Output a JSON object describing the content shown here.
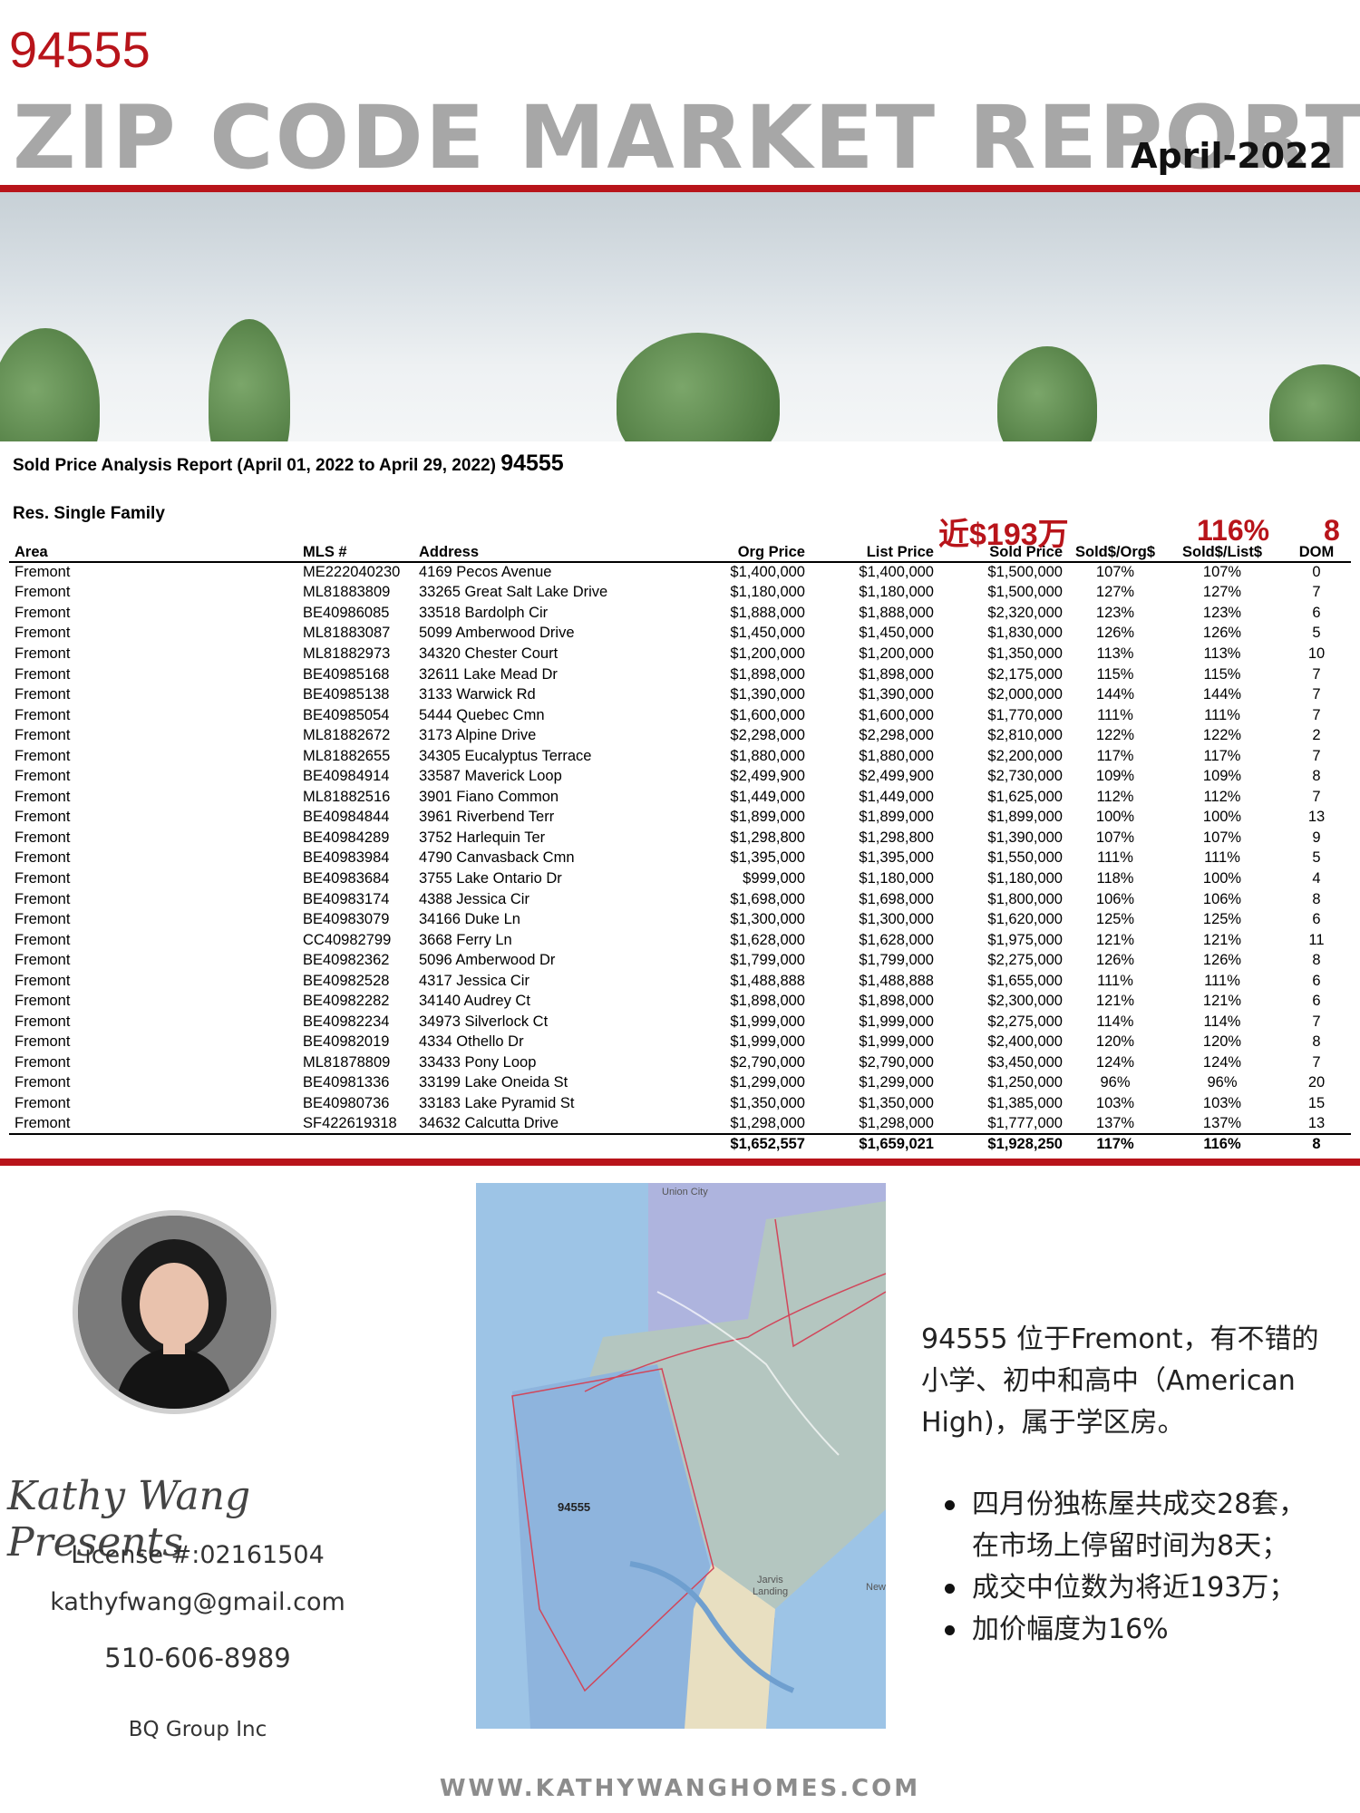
{
  "header": {
    "zip": "94555",
    "title": "ZIP CODE MARKET REPORT",
    "date": "April-2022"
  },
  "report": {
    "title": "Sold Price Analysis Report (April 01, 2022 to April 29, 2022)",
    "zip": "94555",
    "category": "Res. Single Family",
    "highlight_price": "近$193万",
    "highlight_ratio": "116%",
    "highlight_dom": "8",
    "columns": [
      "Area",
      "MLS #",
      "Address",
      "Org Price",
      "List Price",
      "Sold Price",
      "Sold$/Org$",
      "Sold$/List$",
      "DOM"
    ],
    "rows": [
      [
        "Fremont",
        "ME222040230",
        "4169 Pecos Avenue",
        "$1,400,000",
        "$1,400,000",
        "$1,500,000",
        "107%",
        "107%",
        "0"
      ],
      [
        "Fremont",
        "ML81883809",
        "33265 Great Salt Lake Drive",
        "$1,180,000",
        "$1,180,000",
        "$1,500,000",
        "127%",
        "127%",
        "7"
      ],
      [
        "Fremont",
        "BE40986085",
        "33518 Bardolph Cir",
        "$1,888,000",
        "$1,888,000",
        "$2,320,000",
        "123%",
        "123%",
        "6"
      ],
      [
        "Fremont",
        "ML81883087",
        "5099 Amberwood Drive",
        "$1,450,000",
        "$1,450,000",
        "$1,830,000",
        "126%",
        "126%",
        "5"
      ],
      [
        "Fremont",
        "ML81882973",
        "34320 Chester Court",
        "$1,200,000",
        "$1,200,000",
        "$1,350,000",
        "113%",
        "113%",
        "10"
      ],
      [
        "Fremont",
        "BE40985168",
        "32611 Lake Mead Dr",
        "$1,898,000",
        "$1,898,000",
        "$2,175,000",
        "115%",
        "115%",
        "7"
      ],
      [
        "Fremont",
        "BE40985138",
        "3133 Warwick Rd",
        "$1,390,000",
        "$1,390,000",
        "$2,000,000",
        "144%",
        "144%",
        "7"
      ],
      [
        "Fremont",
        "BE40985054",
        "5444 Quebec Cmn",
        "$1,600,000",
        "$1,600,000",
        "$1,770,000",
        "111%",
        "111%",
        "7"
      ],
      [
        "Fremont",
        "ML81882672",
        "3173 Alpine Drive",
        "$2,298,000",
        "$2,298,000",
        "$2,810,000",
        "122%",
        "122%",
        "2"
      ],
      [
        "Fremont",
        "ML81882655",
        "34305 Eucalyptus Terrace",
        "$1,880,000",
        "$1,880,000",
        "$2,200,000",
        "117%",
        "117%",
        "7"
      ],
      [
        "Fremont",
        "BE40984914",
        "33587 Maverick Loop",
        "$2,499,900",
        "$2,499,900",
        "$2,730,000",
        "109%",
        "109%",
        "8"
      ],
      [
        "Fremont",
        "ML81882516",
        "3901 Fiano Common",
        "$1,449,000",
        "$1,449,000",
        "$1,625,000",
        "112%",
        "112%",
        "7"
      ],
      [
        "Fremont",
        "BE40984844",
        "3961 Riverbend Terr",
        "$1,899,000",
        "$1,899,000",
        "$1,899,000",
        "100%",
        "100%",
        "13"
      ],
      [
        "Fremont",
        "BE40984289",
        "3752 Harlequin Ter",
        "$1,298,800",
        "$1,298,800",
        "$1,390,000",
        "107%",
        "107%",
        "9"
      ],
      [
        "Fremont",
        "BE40983984",
        "4790 Canvasback Cmn",
        "$1,395,000",
        "$1,395,000",
        "$1,550,000",
        "111%",
        "111%",
        "5"
      ],
      [
        "Fremont",
        "BE40983684",
        "3755 Lake Ontario Dr",
        "$999,000",
        "$1,180,000",
        "$1,180,000",
        "118%",
        "100%",
        "4"
      ],
      [
        "Fremont",
        "BE40983174",
        "4388 Jessica Cir",
        "$1,698,000",
        "$1,698,000",
        "$1,800,000",
        "106%",
        "106%",
        "8"
      ],
      [
        "Fremont",
        "BE40983079",
        "34166 Duke Ln",
        "$1,300,000",
        "$1,300,000",
        "$1,620,000",
        "125%",
        "125%",
        "6"
      ],
      [
        "Fremont",
        "CC40982799",
        "3668 Ferry Ln",
        "$1,628,000",
        "$1,628,000",
        "$1,975,000",
        "121%",
        "121%",
        "11"
      ],
      [
        "Fremont",
        "BE40982362",
        "5096 Amberwood Dr",
        "$1,799,000",
        "$1,799,000",
        "$2,275,000",
        "126%",
        "126%",
        "8"
      ],
      [
        "Fremont",
        "BE40982528",
        "4317 Jessica Cir",
        "$1,488,888",
        "$1,488,888",
        "$1,655,000",
        "111%",
        "111%",
        "6"
      ],
      [
        "Fremont",
        "BE40982282",
        "34140 Audrey Ct",
        "$1,898,000",
        "$1,898,000",
        "$2,300,000",
        "121%",
        "121%",
        "6"
      ],
      [
        "Fremont",
        "BE40982234",
        "34973 Silverlock Ct",
        "$1,999,000",
        "$1,999,000",
        "$2,275,000",
        "114%",
        "114%",
        "7"
      ],
      [
        "Fremont",
        "BE40982019",
        "4334 Othello Dr",
        "$1,999,000",
        "$1,999,000",
        "$2,400,000",
        "120%",
        "120%",
        "8"
      ],
      [
        "Fremont",
        "ML81878809",
        "33433 Pony Loop",
        "$2,790,000",
        "$2,790,000",
        "$3,450,000",
        "124%",
        "124%",
        "7"
      ],
      [
        "Fremont",
        "BE40981336",
        "33199 Lake Oneida St",
        "$1,299,000",
        "$1,299,000",
        "$1,250,000",
        "96%",
        "96%",
        "20"
      ],
      [
        "Fremont",
        "BE40980736",
        "33183 Lake Pyramid St",
        "$1,350,000",
        "$1,350,000",
        "$1,385,000",
        "103%",
        "103%",
        "15"
      ],
      [
        "Fremont",
        "SF422619318",
        "34632 Calcutta Drive",
        "$1,298,000",
        "$1,298,000",
        "$1,777,000",
        "137%",
        "137%",
        "13"
      ]
    ],
    "totals": [
      "$1,652,557",
      "$1,659,021",
      "$1,928,250",
      "117%",
      "116%",
      "8"
    ]
  },
  "agent": {
    "signature": "Kathy Wang Presents",
    "license": "License #:02161504",
    "email": "kathyfwang@gmail.com",
    "phone": "510-606-8989",
    "company": "BQ Group Inc"
  },
  "map": {
    "city_top": "Union City",
    "zip_label": "94555",
    "place_1": "Jarvis",
    "place_2": "Landing",
    "place_3": "New"
  },
  "summary": {
    "intro": "94555 位于Fremont，有不错的小学、初中和高中（American High)，属于学区房。",
    "bullet_1a": "四月份独栋屋共成交28套，",
    "bullet_1b": "在市场上停留时间为8天；",
    "bullet_2": "成交中位数为将近193万；",
    "bullet_3": "加价幅度为16%"
  },
  "footer": {
    "website": "WWW.KATHYWANGHOMES.COM"
  }
}
